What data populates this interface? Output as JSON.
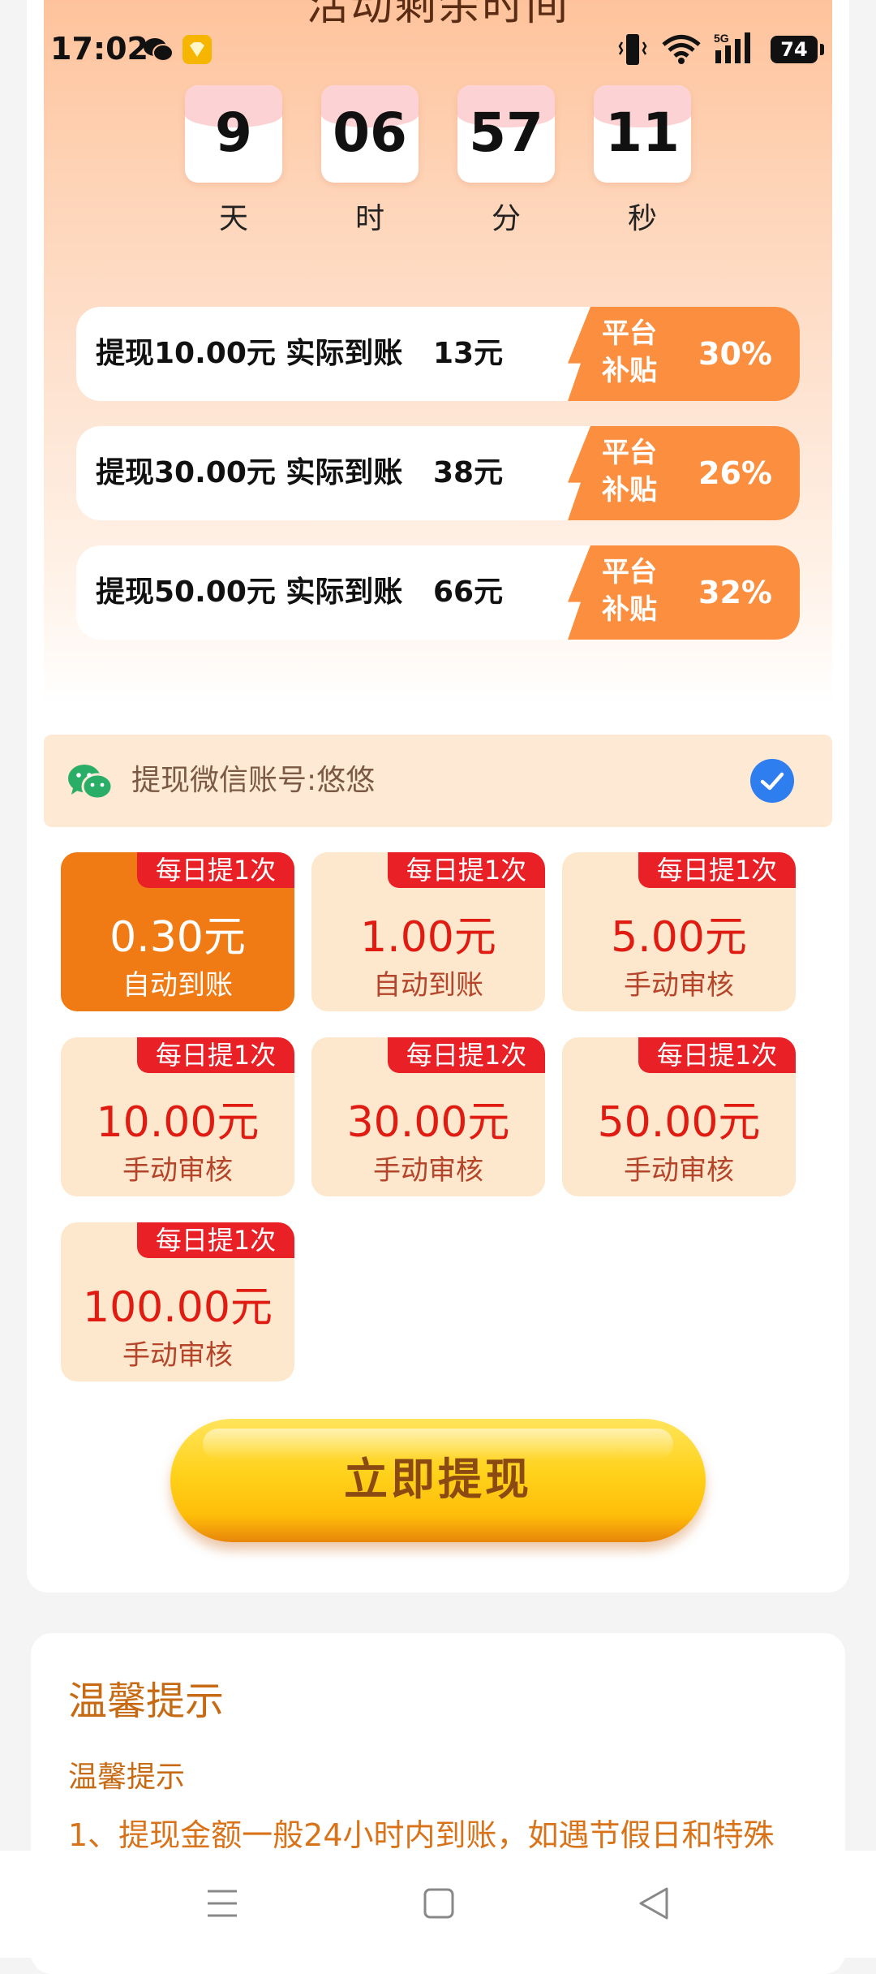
{
  "status_bar": {
    "time": "17:02",
    "battery": "74"
  },
  "hero": {
    "title": "活动剩余时间"
  },
  "countdown": [
    {
      "value": "9",
      "unit": "天"
    },
    {
      "value": "06",
      "unit": "时"
    },
    {
      "value": "57",
      "unit": "分"
    },
    {
      "value": "11",
      "unit": "秒"
    }
  ],
  "offers": [
    {
      "text": "提现10.00元 实际到账   13元",
      "badge": "平台\n补贴",
      "badge_line1": "平台",
      "badge_line2": "补贴",
      "percent": "30%"
    },
    {
      "text": "提现30.00元 实际到账   38元",
      "badge_line1": "平台",
      "badge_line2": "补贴",
      "percent": "26%"
    },
    {
      "text": "提现50.00元 实际到账   66元",
      "badge_line1": "平台",
      "badge_line2": "补贴",
      "percent": "32%"
    }
  ],
  "account": {
    "label": "提现微信账号:悠悠",
    "checked": true
  },
  "amounts": [
    {
      "tag": "每日提1次",
      "amount": "0.30元",
      "sub": "自动到账",
      "selected": true
    },
    {
      "tag": "每日提1次",
      "amount": "1.00元",
      "sub": "自动到账",
      "selected": false
    },
    {
      "tag": "每日提1次",
      "amount": "5.00元",
      "sub": "手动审核",
      "selected": false
    },
    {
      "tag": "每日提1次",
      "amount": "10.00元",
      "sub": "手动审核",
      "selected": false
    },
    {
      "tag": "每日提1次",
      "amount": "30.00元",
      "sub": "手动审核",
      "selected": false
    },
    {
      "tag": "每日提1次",
      "amount": "50.00元",
      "sub": "手动审核",
      "selected": false
    },
    {
      "tag": "每日提1次",
      "amount": "100.00元",
      "sub": "手动审核",
      "selected": false
    }
  ],
  "withdraw_button": {
    "label": "立即提现"
  },
  "tips": {
    "title": "温馨提示",
    "subtitle": "温馨提示",
    "line1": "1、提现金额一般24小时内到账，如遇节假日和特殊"
  },
  "colors": {
    "accent": "#f07a14",
    "badge": "#fb8f3f",
    "tag_red": "#ea2027",
    "tip_text": "#d9731a"
  }
}
